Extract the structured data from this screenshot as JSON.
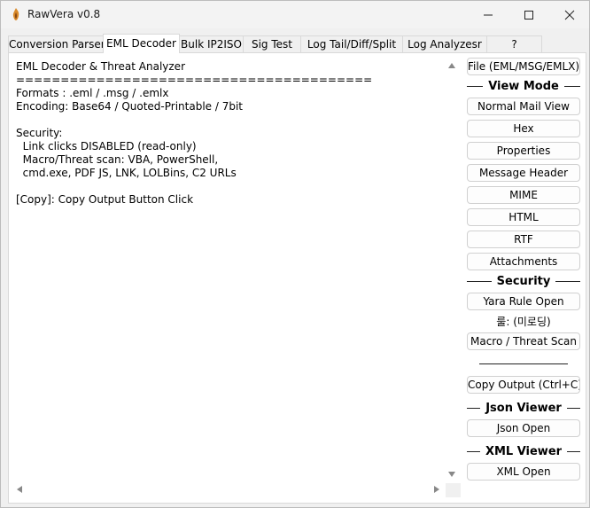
{
  "window": {
    "title": "RawVera v0.8",
    "icon": "flame-app-icon",
    "controls": {
      "minimize": "minimize-icon",
      "maximize": "maximize-icon",
      "close": "close-icon"
    }
  },
  "tabs": [
    {
      "label": "Conversion Parser"
    },
    {
      "label": "EML Decoder",
      "active": true
    },
    {
      "label": "Bulk IP2ISO"
    },
    {
      "label": "Sig Test"
    },
    {
      "label": "Log Tail/Diff/Split"
    },
    {
      "label": "Log Analyzesr"
    },
    {
      "label": "?"
    }
  ],
  "output": {
    "text": "EML Decoder & Threat Analyzer\n========================================\nFormats : .eml / .msg / .emlx\nEncoding: Base64 / Quoted-Printable / 7bit\n\nSecurity:\n  Link clicks DISABLED (read-only)\n  Macro/Threat scan: VBA, PowerShell,\n  cmd.exe, PDF JS, LNK, LOLBins, C2 URLs\n\n[Copy]: Copy Output Button Click"
  },
  "side": {
    "file_button": "File (EML/MSG/EMLX)",
    "view_mode_header": "View Mode",
    "view_buttons": [
      "Normal Mail View",
      "Hex",
      "Properties",
      "Message Header",
      "MIME",
      "HTML",
      "RTF",
      "Attachments"
    ],
    "security_header": "Security",
    "yara_button": "Yara Rule Open",
    "yara_status": "룰: (미로딩)",
    "macro_button": "Macro / Threat Scan",
    "copy_button": "Copy Output (Ctrl+C)",
    "json_header": "Json Viewer",
    "json_button": "Json Open",
    "xml_header": "XML Viewer",
    "xml_button": "XML Open"
  }
}
